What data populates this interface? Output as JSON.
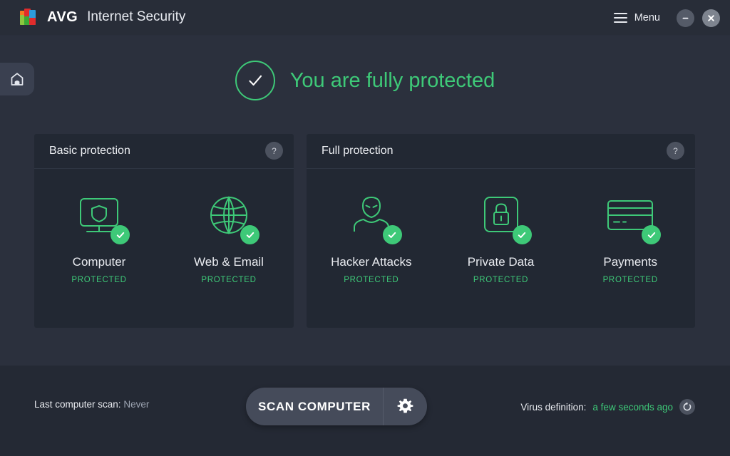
{
  "window": {
    "brand_word": "AVG",
    "product_name": "Internet Security",
    "menu_label": "Menu",
    "minimize_icon": "minimize-icon",
    "close_icon": "close-icon",
    "hamburger_icon": "hamburger-icon"
  },
  "nav": {
    "home_tab_icon": "home-icon"
  },
  "status": {
    "icon": "check-circle-icon",
    "text": "You are fully protected",
    "color": "#3ec978"
  },
  "panels": [
    {
      "title": "Basic protection",
      "help_label": "?",
      "tiles": [
        {
          "icon": "computer-shield-icon",
          "name": "Computer",
          "state": "PROTECTED",
          "badge": "check-badge-icon"
        },
        {
          "icon": "globe-icon",
          "name": "Web & Email",
          "state": "PROTECTED",
          "badge": "check-badge-icon"
        }
      ]
    },
    {
      "title": "Full protection",
      "help_label": "?",
      "tiles": [
        {
          "icon": "hacker-icon",
          "name": "Hacker Attacks",
          "state": "PROTECTED",
          "badge": "check-badge-icon"
        },
        {
          "icon": "lock-square-icon",
          "name": "Private Data",
          "state": "PROTECTED",
          "badge": "check-badge-icon"
        },
        {
          "icon": "credit-card-icon",
          "name": "Payments",
          "state": "PROTECTED",
          "badge": "check-badge-icon"
        }
      ]
    }
  ],
  "footer": {
    "last_scan_label": "Last computer scan:",
    "last_scan_value": "Never",
    "scan_button_label": "SCAN COMPUTER",
    "scan_settings_icon": "gear-icon",
    "virus_def_label": "Virus definition:",
    "virus_def_value": "a few seconds ago",
    "refresh_icon": "refresh-icon"
  },
  "colors": {
    "accent_green": "#3ec978",
    "window_bg": "#2b303d",
    "panel_bg": "#222833",
    "titlebar_bg": "#282d38",
    "footer_bg": "#242934"
  }
}
